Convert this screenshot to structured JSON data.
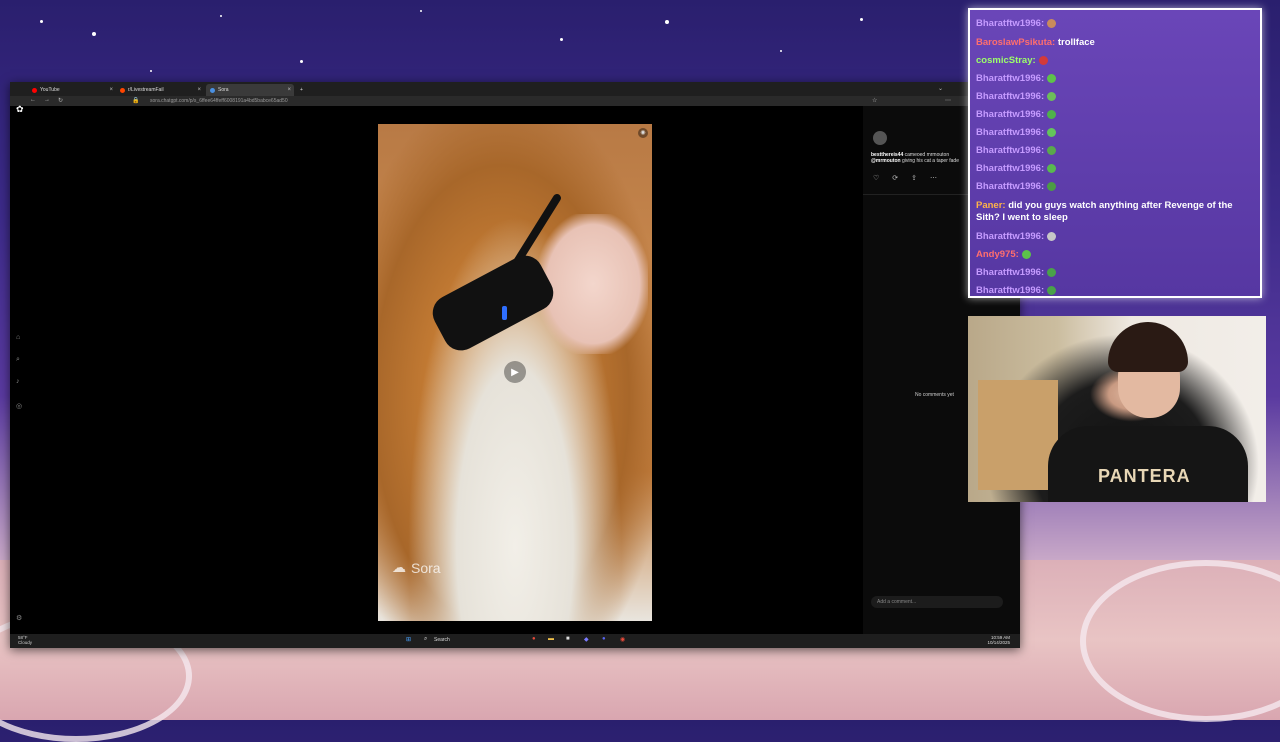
{
  "browser": {
    "tabs": [
      {
        "label": "YouTube",
        "color": "#ff0000"
      },
      {
        "label": "r/LivestreamFail",
        "color": "#ff4500"
      },
      {
        "label": "Sora",
        "color": "#4a90e2",
        "active": true
      }
    ],
    "new_tab": "+",
    "url": "sora.chatgpt.com/p/s_6ffee64ffeff6008191a4bd5babce65ad50"
  },
  "post": {
    "author": "bestthereis44",
    "cameo_text": "cameoed mrmouton",
    "caption_user": "@mrmouton",
    "caption": "giving his cat a taper fade",
    "no_comments": "No comments yet",
    "comment_placeholder": "Add a comment...",
    "watermark": "Sora"
  },
  "taskbar": {
    "weather_temp": "58°F",
    "weather_desc": "Cloudy",
    "search": "Search",
    "time": "10:59 AM",
    "date": "10/14/2025"
  },
  "chat": {
    "messages": [
      {
        "user": "Bharatftw1996",
        "text": "",
        "color": "#c59bff",
        "emote": "#c98b5c"
      },
      {
        "user": "BaroslawPsikuta",
        "text": "trollface",
        "color": "#ff6e6e",
        "emote": ""
      },
      {
        "user": "cosmicStray",
        "text": "",
        "color": "#9cff6a",
        "emote": "#d43a3a"
      },
      {
        "user": "Bharatftw1996",
        "text": "",
        "color": "#c59bff",
        "emote": "#5ec24a"
      },
      {
        "user": "Bharatftw1996",
        "text": "",
        "color": "#c59bff",
        "emote": "#6dbd5a"
      },
      {
        "user": "Bharatftw1996",
        "text": "",
        "color": "#c59bff",
        "emote": "#4fb14a"
      },
      {
        "user": "Bharatftw1996",
        "text": "",
        "color": "#c59bff",
        "emote": "#64c45c"
      },
      {
        "user": "Bharatftw1996",
        "text": "",
        "color": "#c59bff",
        "emote": "#5aa84c"
      },
      {
        "user": "Bharatftw1996",
        "text": "",
        "color": "#c59bff",
        "emote": "#59b84f"
      },
      {
        "user": "Bharatftw1996",
        "text": "",
        "color": "#c59bff",
        "emote": "#4c9b45"
      },
      {
        "user": "Paner",
        "text": "did you guys watch anything after Revenge of the Sith? I went to sleep",
        "color": "#ffb347",
        "emote": ""
      },
      {
        "user": "Bharatftw1996",
        "text": "",
        "color": "#c59bff",
        "emote": "#c7c7c7"
      },
      {
        "user": "Andy975",
        "text": "",
        "color": "#ff6e6e",
        "emote": "#5cc24a"
      },
      {
        "user": "Bharatftw1996",
        "text": "",
        "color": "#c59bff",
        "emote": "#4aa14a"
      },
      {
        "user": "Bharatftw1996",
        "text": "",
        "color": "#c59bff",
        "emote": "#4aa14a"
      }
    ]
  },
  "webcam": {
    "shirt_text": "PANTERA"
  }
}
